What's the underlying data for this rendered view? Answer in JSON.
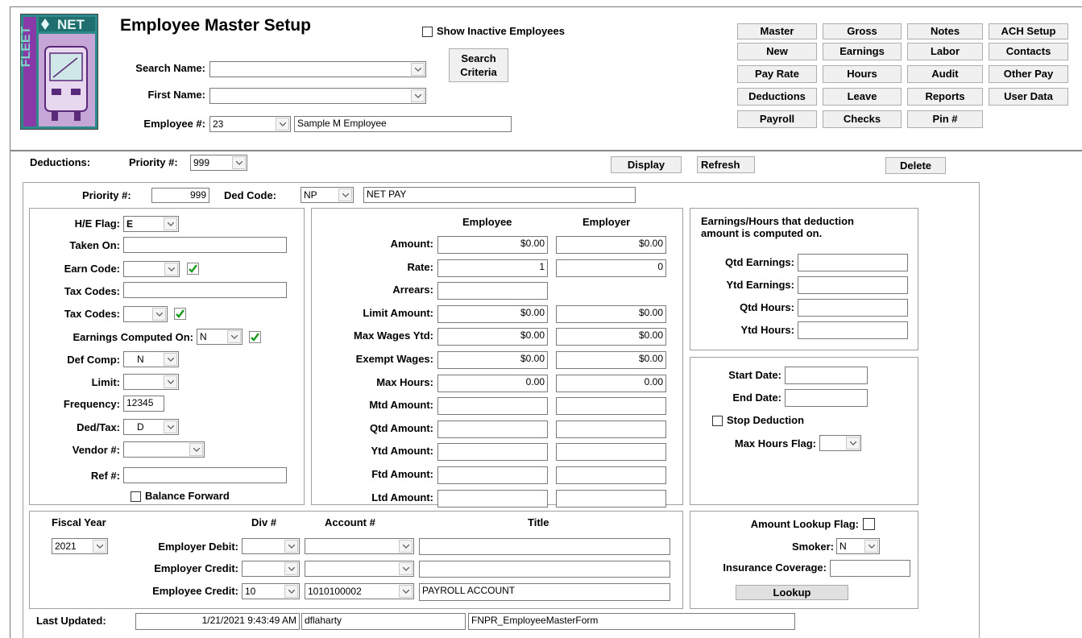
{
  "logo": {
    "net": "NET",
    "fleet": "FLEET"
  },
  "header": {
    "title": "Employee Master Setup",
    "show_inactive_label": "Show Inactive Employees",
    "search_name_label": "Search Name:",
    "first_name_label": "First Name:",
    "employee_num_label": "Employee #:",
    "employee_num": "23",
    "employee_name": "Sample M Employee",
    "search_criteria_line1": "Search",
    "search_criteria_line2": "Criteria"
  },
  "nav_buttons": [
    "Master",
    "Gross",
    "Notes",
    "ACH Setup",
    "New",
    "Earnings",
    "Labor",
    "Contacts",
    "Pay Rate",
    "Hours",
    "Audit",
    "Other Pay",
    "Deductions",
    "Leave",
    "Reports",
    "User Data",
    "Payroll",
    "Checks",
    "Pin #"
  ],
  "deductions_bar": {
    "deductions_label": "Deductions:",
    "priority_label": "Priority #:",
    "priority": "999",
    "display": "Display",
    "refresh": "Refresh",
    "delete": "Delete"
  },
  "top_row": {
    "priority_label": "Priority #:",
    "priority": "999",
    "ded_code_label": "Ded Code:",
    "ded_code": "NP",
    "ded_desc": "NET PAY"
  },
  "left": {
    "he_flag_label": "H/E Flag:",
    "he_flag": "E",
    "taken_on_label": "Taken On:",
    "earn_code_label": "Earn Code:",
    "tax_codes_label": "Tax Codes:",
    "tax_codes2_label": "Tax Codes:",
    "earnings_computed_label": "Earnings Computed On:",
    "earnings_computed": "N",
    "def_comp_label": "Def Comp:",
    "def_comp": "N",
    "limit_label": "Limit:",
    "frequency_label": "Frequency:",
    "frequency": "12345",
    "ded_tax_label": "Ded/Tax:",
    "ded_tax": "D",
    "vendor_label": "Vendor #:",
    "ref_label": "Ref #:",
    "balance_forward": "Balance Forward"
  },
  "amounts": {
    "employee_header": "Employee",
    "employer_header": "Employer",
    "rows": [
      {
        "label": "Amount:",
        "employee": "$0.00",
        "employer": "$0.00"
      },
      {
        "label": "Rate:",
        "employee": "1",
        "employer": "0"
      },
      {
        "label": "Arrears:",
        "employee": "",
        "employer": null
      },
      {
        "label": "Limit Amount:",
        "employee": "$0.00",
        "employer": "$0.00"
      },
      {
        "label": "Max Wages Ytd:",
        "employee": "$0.00",
        "employer": "$0.00"
      },
      {
        "label": "Exempt Wages:",
        "employee": "$0.00",
        "employer": "$0.00"
      },
      {
        "label": "Max Hours:",
        "employee": "0.00",
        "employer": "0.00"
      },
      {
        "label": "Mtd Amount:",
        "employee": "",
        "employer": ""
      },
      {
        "label": "Qtd Amount:",
        "employee": "",
        "employer": ""
      },
      {
        "label": "Ytd Amount:",
        "employee": "",
        "employer": ""
      },
      {
        "label": "Ftd Amount:",
        "employee": "",
        "employer": ""
      },
      {
        "label": "Ltd Amount:",
        "employee": "",
        "employer": ""
      }
    ]
  },
  "computed": {
    "heading_line1": "Earnings/Hours that deduction",
    "heading_line2": "amount is computed on.",
    "qtd_earnings": "Qtd Earnings:",
    "ytd_earnings": "Ytd Earnings:",
    "qtd_hours": "Qtd Hours:",
    "ytd_hours": "Ytd Hours:"
  },
  "dates": {
    "start_label": "Start Date:",
    "end_label": "End Date:",
    "stop_deduction": "Stop Deduction",
    "max_hours_flag_label": "Max Hours Flag:"
  },
  "accounts": {
    "fiscal_year_label": "Fiscal Year",
    "fiscal_year": "2021",
    "div_header": "Div #",
    "account_header": "Account #",
    "title_header": "Title",
    "employer_debit": "Employer Debit:",
    "employer_credit": "Employer Credit:",
    "employee_credit": "Employee Credit:",
    "emp_credit_div": "10",
    "emp_credit_acct": "1010100002",
    "emp_credit_title": "PAYROLL ACCOUNT"
  },
  "insurance": {
    "amount_lookup_label": "Amount Lookup Flag:",
    "smoker_label": "Smoker:",
    "smoker": "N",
    "coverage_label": "Insurance Coverage:",
    "lookup": "Lookup"
  },
  "footer": {
    "last_updated_label": "Last Updated:",
    "date": "1/21/2021 9:43:49 AM",
    "user": "dflaharty",
    "form": "FNPR_EmployeeMasterForm"
  },
  "colors": {
    "check_green": "#1a9a1a",
    "logo_teal": "#2e8b8b",
    "logo_purple": "#7a3a9a"
  }
}
